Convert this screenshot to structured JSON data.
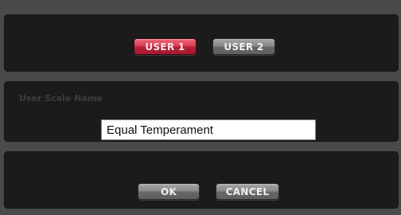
{
  "scale_selector": {
    "user1_label": "USER 1",
    "user2_label": "USER 2",
    "selected": "USER 1"
  },
  "scale_name": {
    "label": "User Scale Name",
    "value": "Equal Temperament"
  },
  "actions": {
    "ok_label": "OK",
    "cancel_label": "CANCEL"
  },
  "colors": {
    "selected_button": "#d83a50",
    "panel_background": "#1b1b1b",
    "frame_background": "#4a4a4a"
  }
}
